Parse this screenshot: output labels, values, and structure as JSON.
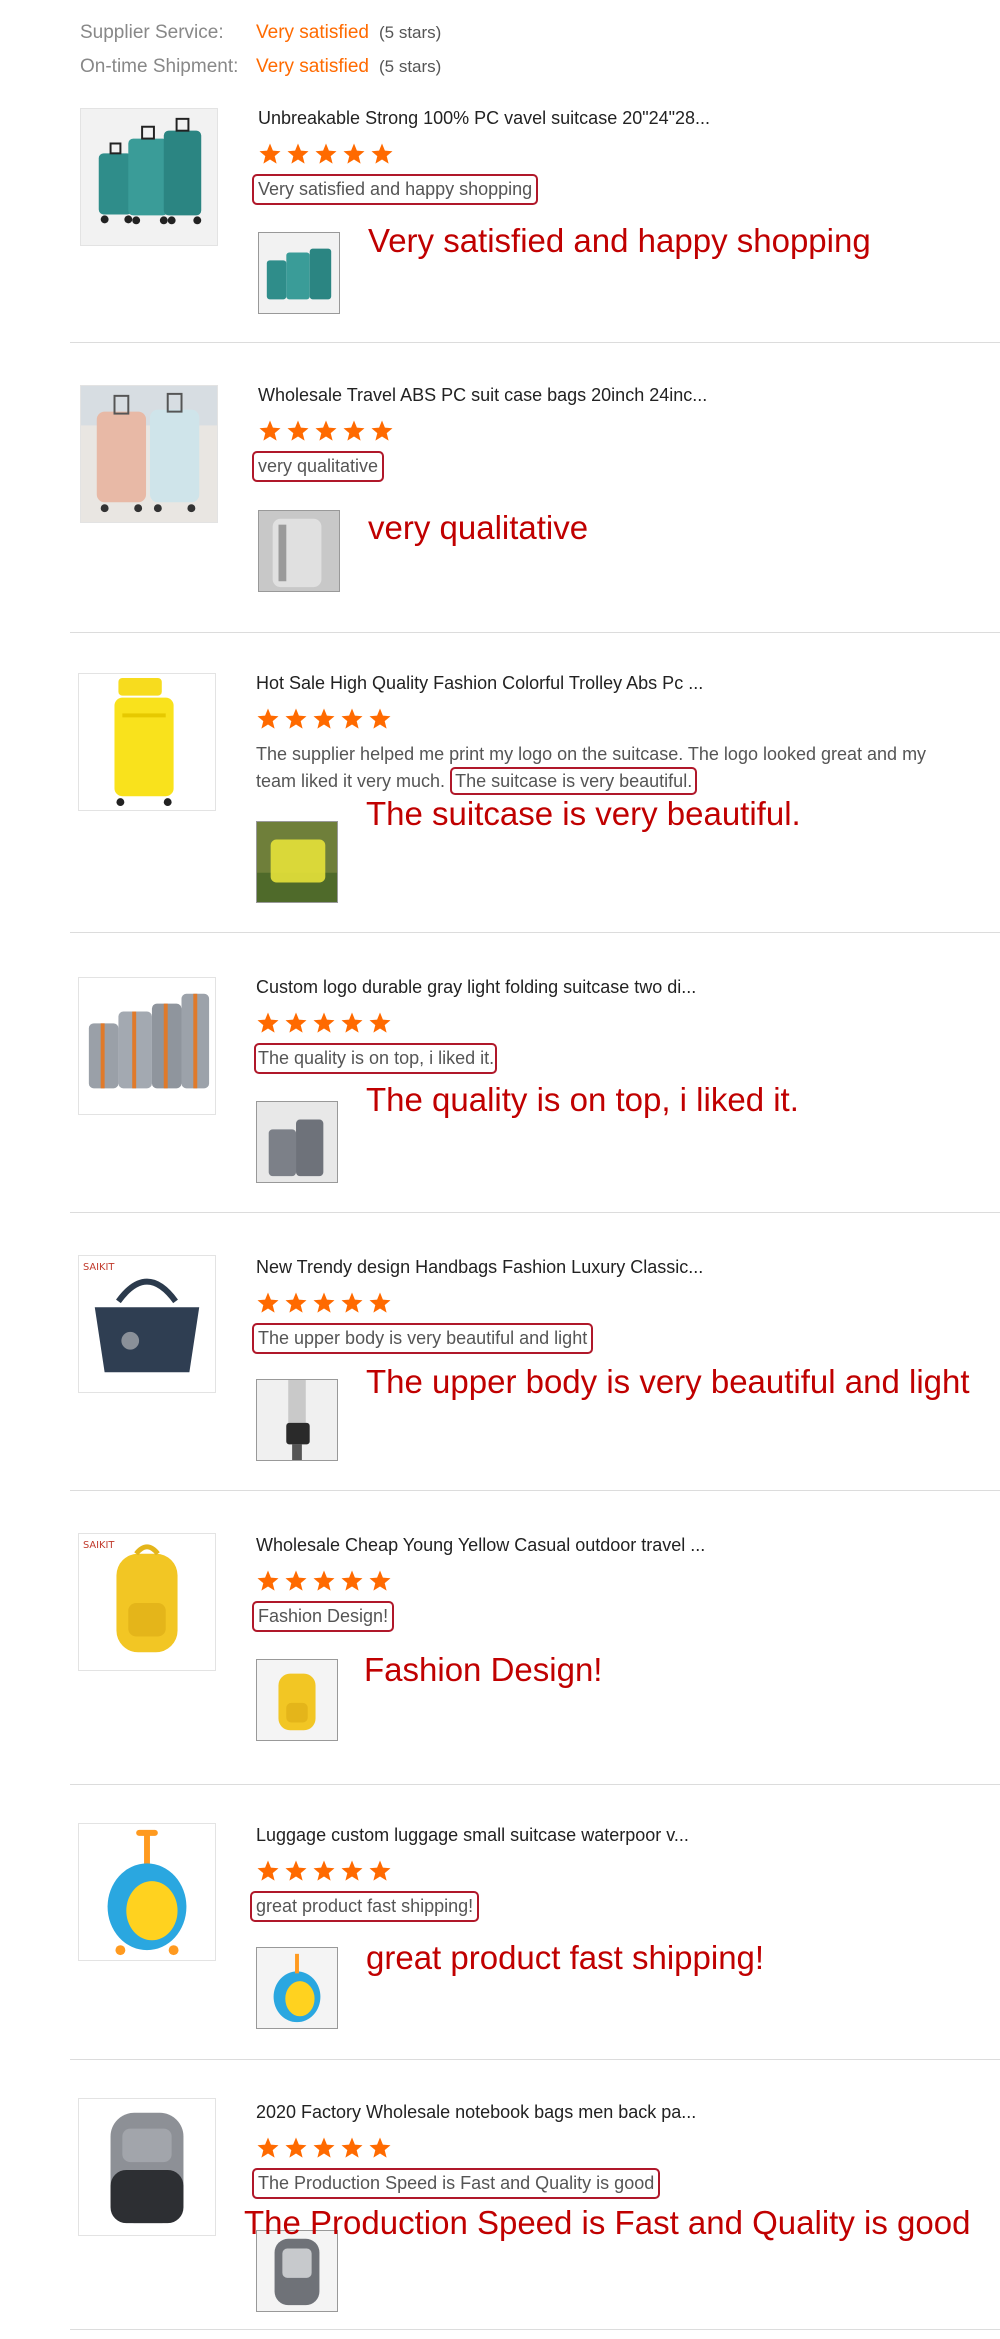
{
  "summary": {
    "rows": [
      {
        "label": "Supplier Service:",
        "value": "Very satisfied",
        "stars": "(5 stars)"
      },
      {
        "label": "On-time Shipment:",
        "value": "Very satisfied",
        "stars": "(5 stars)"
      }
    ]
  },
  "colors": {
    "accent": "#ff6a00",
    "highlight_border": "#b0182a",
    "caption": "#c00000"
  },
  "reviews": [
    {
      "title": "Unbreakable Strong 100% PC vavel suitcase 20\"24\"28...",
      "rating": 5,
      "comment_pre": "",
      "comment_hl": "Very satisfied and happy shopping",
      "caption": "Very satisfied and happy shopping",
      "image_icon": "teal-luggage-set-icon",
      "thumb_icon": "teal-luggage-set-icon"
    },
    {
      "title": "Wholesale Travel ABS PC suit case bags 20inch 24inc...",
      "rating": 5,
      "comment_pre": "",
      "comment_hl": "very qualitative",
      "caption": "very qualitative",
      "image_icon": "pastel-suitcases-icon",
      "thumb_icon": "grey-suitcase-icon"
    },
    {
      "title": "Hot Sale High Quality Fashion Colorful Trolley Abs Pc ...",
      "rating": 5,
      "comment_pre": "The supplier helped me print my logo on the suitcase. The logo looked great and my team liked it very much.",
      "comment_hl": "The suitcase is very beautiful.",
      "caption": "The suitcase is very beautiful.",
      "image_icon": "yellow-suitcase-icon",
      "thumb_icon": "yellow-suitcase-on-grass-icon"
    },
    {
      "title": "Custom logo durable gray light folding suitcase two di...",
      "rating": 5,
      "comment_pre": "",
      "comment_hl": "The quality is on top, i liked it.",
      "caption": "The quality is on top, i liked it.",
      "image_icon": "gray-luggage-set-icon",
      "thumb_icon": "gray-suitcase-pair-icon"
    },
    {
      "title": "New Trendy design Handbags Fashion Luxury Classic...",
      "rating": 5,
      "comment_pre": "",
      "comment_hl": "The upper body is very beautiful and light",
      "caption": "The upper body is very beautiful and light",
      "image_icon": "navy-handbag-icon",
      "thumb_icon": "handbag-worn-icon"
    },
    {
      "title": "Wholesale Cheap Young Yellow Casual outdoor travel ...",
      "rating": 5,
      "comment_pre": "",
      "comment_hl": "Fashion Design!",
      "caption": "Fashion Design!",
      "image_icon": "yellow-backpack-icon",
      "thumb_icon": "yellow-backpack-icon"
    },
    {
      "title": "Luggage custom luggage small suitcase waterpoor v...",
      "rating": 5,
      "comment_pre": "",
      "comment_hl": "great product fast shipping!",
      "caption": "great product fast shipping!",
      "image_icon": "kids-dinosaur-suitcase-icon",
      "thumb_icon": "kids-dinosaur-suitcase-icon"
    },
    {
      "title": "2020 Factory Wholesale notebook bags men back pa...",
      "rating": 5,
      "comment_pre": "",
      "comment_hl": "The Production Speed is Fast and Quality is good",
      "caption": "The Production Speed is Fast and Quality is good",
      "image_icon": "gray-laptop-backpack-icon",
      "thumb_icon": "open-laptop-backpack-icon"
    }
  ]
}
